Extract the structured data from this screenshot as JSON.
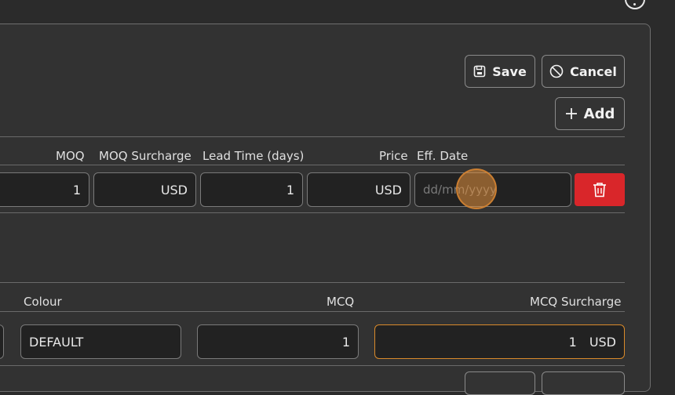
{
  "toolbar": {
    "save_label": "Save",
    "cancel_label": "Cancel",
    "add_label": "Add"
  },
  "pricing_table": {
    "headers": {
      "moq": "MOQ",
      "moq_surcharge": "MOQ Surcharge",
      "lead_time": "Lead Time (days)",
      "price": "Price",
      "eff_date": "Eff. Date"
    },
    "row": {
      "moq": "1",
      "moq_surcharge": "USD",
      "lead_time": "1",
      "price": "USD",
      "eff_date_placeholder": "dd/mm/yyyy"
    }
  },
  "colour_table": {
    "headers": {
      "colour": "Colour",
      "mcq": "MCQ",
      "mcq_surcharge": "MCQ Surcharge"
    },
    "row": {
      "colour": "DEFAULT",
      "mcq": "1",
      "mcq_surcharge_value": "1",
      "mcq_surcharge_currency": "USD"
    }
  },
  "colors": {
    "delete_button": "#d9262a",
    "focus_border": "#d98a2b"
  }
}
